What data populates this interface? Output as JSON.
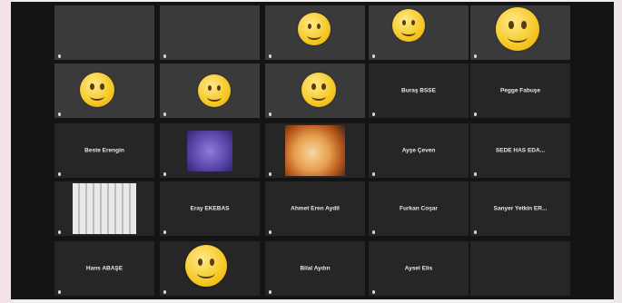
{
  "tiles": [
    {
      "id": "t1",
      "kind": "video",
      "bg": "bg-a",
      "center": "",
      "label": "",
      "emoji": false
    },
    {
      "id": "t2",
      "kind": "video",
      "bg": "bg-b",
      "center": "",
      "label": "",
      "emoji": false
    },
    {
      "id": "t3",
      "kind": "video",
      "bg": "bg-c",
      "center": "",
      "label": "",
      "emoji": true
    },
    {
      "id": "t4",
      "kind": "video",
      "bg": "bg-d",
      "center": "",
      "label": "",
      "emoji": true
    },
    {
      "id": "t5",
      "kind": "video",
      "bg": "bg-e",
      "center": "",
      "label": "",
      "emoji": true
    },
    {
      "id": "t6",
      "kind": "video",
      "bg": "bg-f",
      "center": "",
      "label": "",
      "emoji": true
    },
    {
      "id": "t7",
      "kind": "video",
      "bg": "bg-g",
      "center": "",
      "label": "",
      "emoji": true
    },
    {
      "id": "t8",
      "kind": "video",
      "bg": "bg-h",
      "center": "",
      "label": "",
      "emoji": true
    },
    {
      "id": "t9",
      "kind": "name",
      "center": "Buraş BSSE",
      "label": ""
    },
    {
      "id": "t10",
      "kind": "name",
      "center": "Pegge Fabuşe",
      "label": ""
    },
    {
      "id": "t11",
      "kind": "name",
      "center": "Beste Erengin",
      "label": ""
    },
    {
      "id": "t12",
      "kind": "purple",
      "center": "",
      "label": ""
    },
    {
      "id": "t13",
      "kind": "flower",
      "center": "",
      "label": ""
    },
    {
      "id": "t14",
      "kind": "name",
      "center": "Ayşe Çeven",
      "label": ""
    },
    {
      "id": "t15",
      "kind": "name",
      "center": "SEDE HAS EDA...",
      "label": ""
    },
    {
      "id": "t16",
      "kind": "doc",
      "center": "",
      "label": ""
    },
    {
      "id": "t17",
      "kind": "name",
      "center": "Eray EKEBAS",
      "label": ""
    },
    {
      "id": "t18",
      "kind": "name",
      "center": "Ahmet Eren Aydil",
      "label": ""
    },
    {
      "id": "t19",
      "kind": "name",
      "center": "Furkan Coşar",
      "label": ""
    },
    {
      "id": "t20",
      "kind": "name",
      "center": "Sanyer Yetkin ER...",
      "label": ""
    },
    {
      "id": "t21",
      "kind": "name",
      "center": "Hans ABAŞE",
      "label": ""
    },
    {
      "id": "t22",
      "kind": "emojiOnly",
      "center": "",
      "label": ""
    },
    {
      "id": "t23",
      "kind": "name",
      "center": "Bilal Aydın",
      "label": ""
    },
    {
      "id": "t24",
      "kind": "name",
      "center": "Aysel Elis",
      "label": ""
    },
    {
      "id": "t25",
      "kind": "blank",
      "center": "",
      "label": ""
    }
  ]
}
